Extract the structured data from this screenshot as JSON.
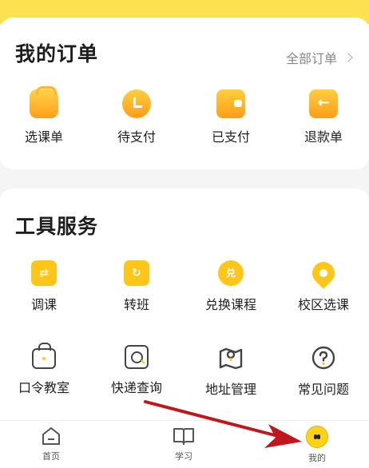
{
  "orders": {
    "title": "我的订单",
    "all_link": "全部订单",
    "items": [
      {
        "label": "选课单",
        "icon": "cart-icon"
      },
      {
        "label": "待支付",
        "icon": "clock-icon"
      },
      {
        "label": "已支付",
        "icon": "wallet-icon"
      },
      {
        "label": "退款单",
        "icon": "refund-icon"
      }
    ]
  },
  "tools": {
    "title": "工具服务",
    "items": [
      {
        "label": "调课",
        "icon": "swap-icon",
        "glyph": "⇄"
      },
      {
        "label": "转班",
        "icon": "refresh-icon",
        "glyph": "↻"
      },
      {
        "label": "兑换课程",
        "icon": "redeem-icon",
        "glyph": "兑"
      },
      {
        "label": "校区选课",
        "icon": "location-pin-icon"
      },
      {
        "label": "口令教室",
        "icon": "lock-bag-icon"
      },
      {
        "label": "快递查询",
        "icon": "search-box-icon"
      },
      {
        "label": "地址管理",
        "icon": "map-pin-icon"
      },
      {
        "label": "常见问题",
        "icon": "help-icon"
      }
    ]
  },
  "nav": {
    "items": [
      {
        "label": "首页",
        "icon": "home-icon"
      },
      {
        "label": "学习",
        "icon": "book-icon"
      },
      {
        "label": "我的",
        "icon": "profile-face-icon"
      }
    ]
  },
  "colors": {
    "accent": "#ffc61a",
    "top_band": "#fde151",
    "annotation_arrow": "#c0171e"
  }
}
